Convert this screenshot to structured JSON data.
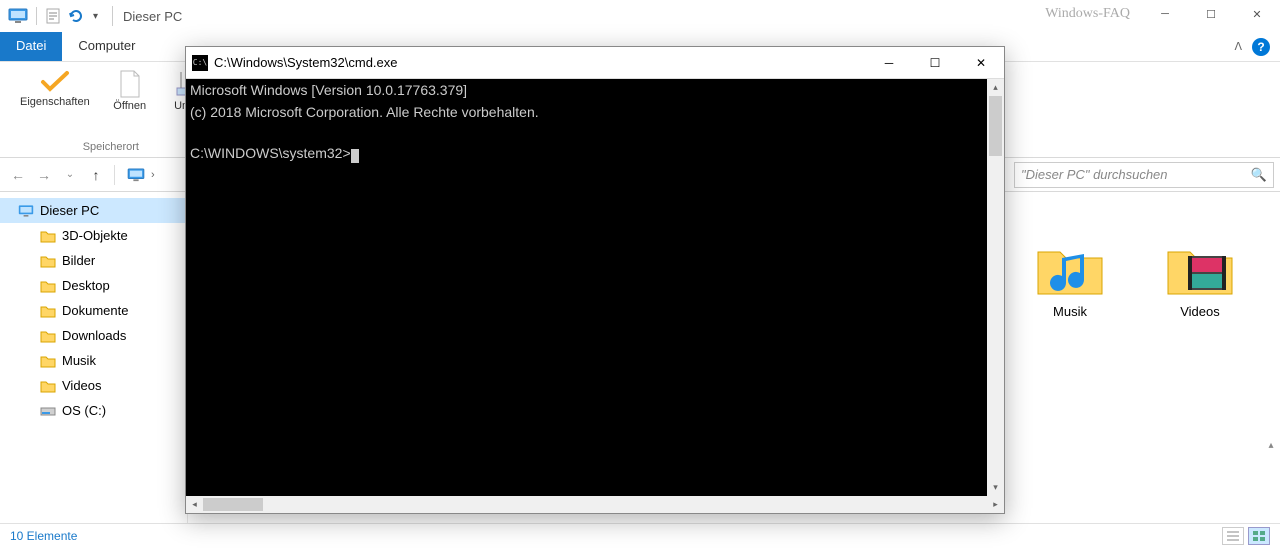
{
  "explorer": {
    "title": "Dieser PC",
    "watermark": "Windows-FAQ",
    "tabs": {
      "file": "Datei",
      "computer": "Computer"
    },
    "ribbon": {
      "properties": "Eigenschaften",
      "open": "Öffnen",
      "rename": "Umb",
      "group_location": "Speicherort"
    },
    "search_placeholder": "\"Dieser PC\" durchsuchen",
    "sidebar": {
      "root": "Dieser PC",
      "items": [
        "3D-Objekte",
        "Bilder",
        "Desktop",
        "Dokumente",
        "Downloads",
        "Musik",
        "Videos",
        "OS (C:)"
      ]
    },
    "content": {
      "music": "Musik",
      "videos": "Videos"
    },
    "status": "10 Elemente"
  },
  "cmd": {
    "title": "C:\\Windows\\System32\\cmd.exe",
    "line1": "Microsoft Windows [Version 10.0.17763.379]",
    "line2": "(c) 2018 Microsoft Corporation. Alle Rechte vorbehalten.",
    "prompt": "C:\\WINDOWS\\system32>"
  }
}
